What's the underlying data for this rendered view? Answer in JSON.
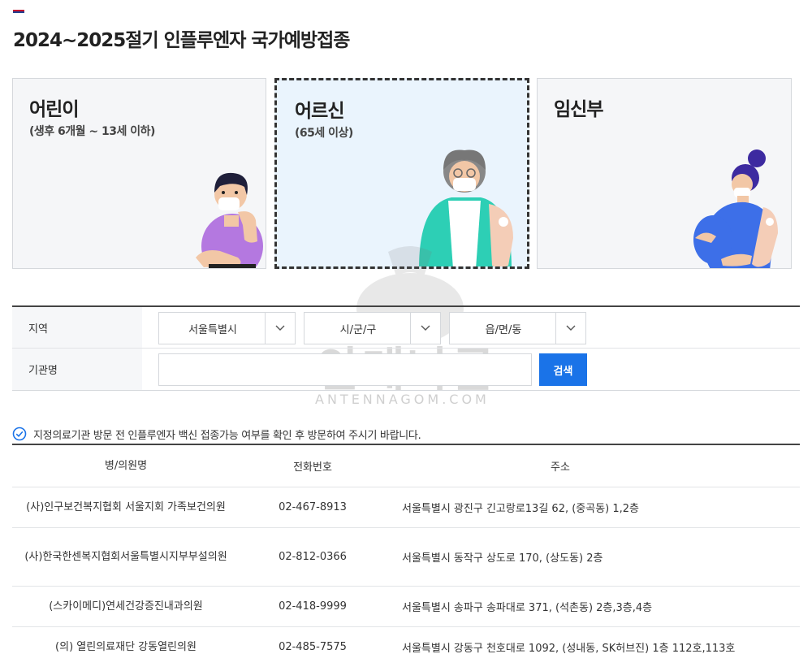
{
  "page": {
    "title": "2024~2025절기 인플루엔자 국가예방접종"
  },
  "cards": [
    {
      "title": "어린이",
      "subtitle": "(생후 6개월 ~ 13세 이하)"
    },
    {
      "title": "어르신",
      "subtitle": "(65세 이상)"
    },
    {
      "title": "임신부",
      "subtitle": ""
    }
  ],
  "watermark": {
    "text": "안테나곰",
    "sub": "ANTENNAGOM.COM"
  },
  "search": {
    "region_label": "지역",
    "selects": [
      "서울특별시",
      "시/군/구",
      "읍/면/동"
    ],
    "name_label": "기관명",
    "name_value": "",
    "button": "검색"
  },
  "notice": "지정의료기관 방문 전 인플루엔자 백신 접종가능 여부를 확인 후 방문하여 주시기 바랍니다.",
  "table": {
    "headers": [
      "병/의원명",
      "전화번호",
      "주소"
    ],
    "rows": [
      {
        "name": "(사)인구보건복지협회 서울지회 가족보건의원",
        "tel": "02-467-8913",
        "addr": "서울특별시 광진구 긴고랑로13길 62, (중곡동) 1,2층"
      },
      {
        "name": "(사)한국한센복지협회서울특별시지부부설의원",
        "tel": "02-812-0366",
        "addr": "서울특별시 동작구 상도로 170, (상도동) 2층"
      },
      {
        "name": "(스카이메디)연세건강증진내과의원",
        "tel": "02-418-9999",
        "addr": "서울특별시 송파구 송파대로 371, (석촌동) 2층,3층,4층"
      },
      {
        "name": "(의) 열린의료재단 강동열린의원",
        "tel": "02-485-7575",
        "addr": "서울특별시 강동구 천호대로 1092, (성내동, SK허브진) 1층 112호,113호"
      }
    ]
  },
  "colors": {
    "accent": "#1a73e8",
    "selected_card_bg": "#eaf4fd",
    "card_bg": "#f5f6f8"
  }
}
